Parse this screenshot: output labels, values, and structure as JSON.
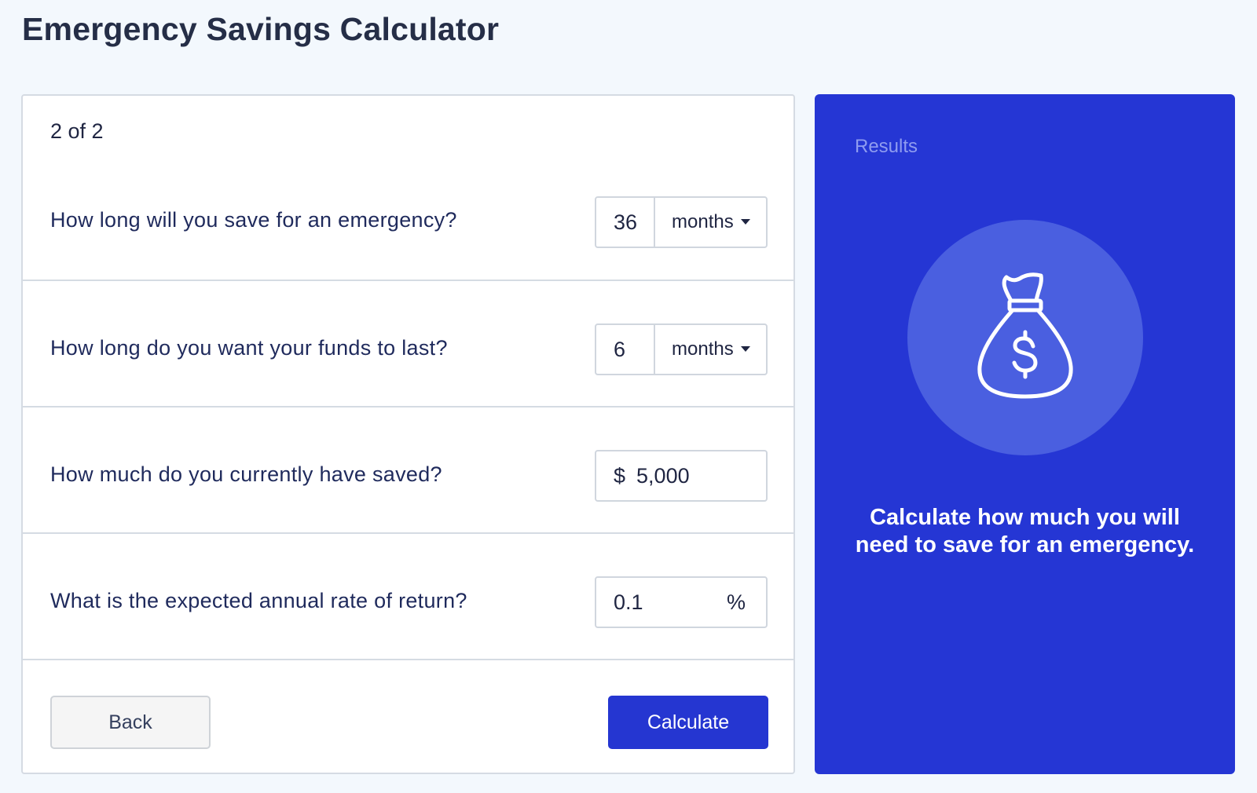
{
  "page": {
    "title": "Emergency Savings Calculator"
  },
  "form": {
    "step": "2 of 2",
    "questions": [
      {
        "label": "How long will you save for an emergency?",
        "value": "36",
        "unit": "months"
      },
      {
        "label": "How long do you want your funds to last?",
        "value": "6",
        "unit": "months"
      },
      {
        "label": "How much do you currently have saved?",
        "currency": "$",
        "value": "5,000"
      },
      {
        "label": "What is the expected annual rate of return?",
        "value": "0.1",
        "unit": "%"
      }
    ],
    "back_label": "Back",
    "calculate_label": "Calculate"
  },
  "results": {
    "label": "Results",
    "icon": "money-bag-icon",
    "message": "Calculate how much you will need to save for an emergency."
  },
  "colors": {
    "accent": "#2536d4",
    "icon_circle": "#4a5fe0",
    "background": "#f3f8fd"
  }
}
